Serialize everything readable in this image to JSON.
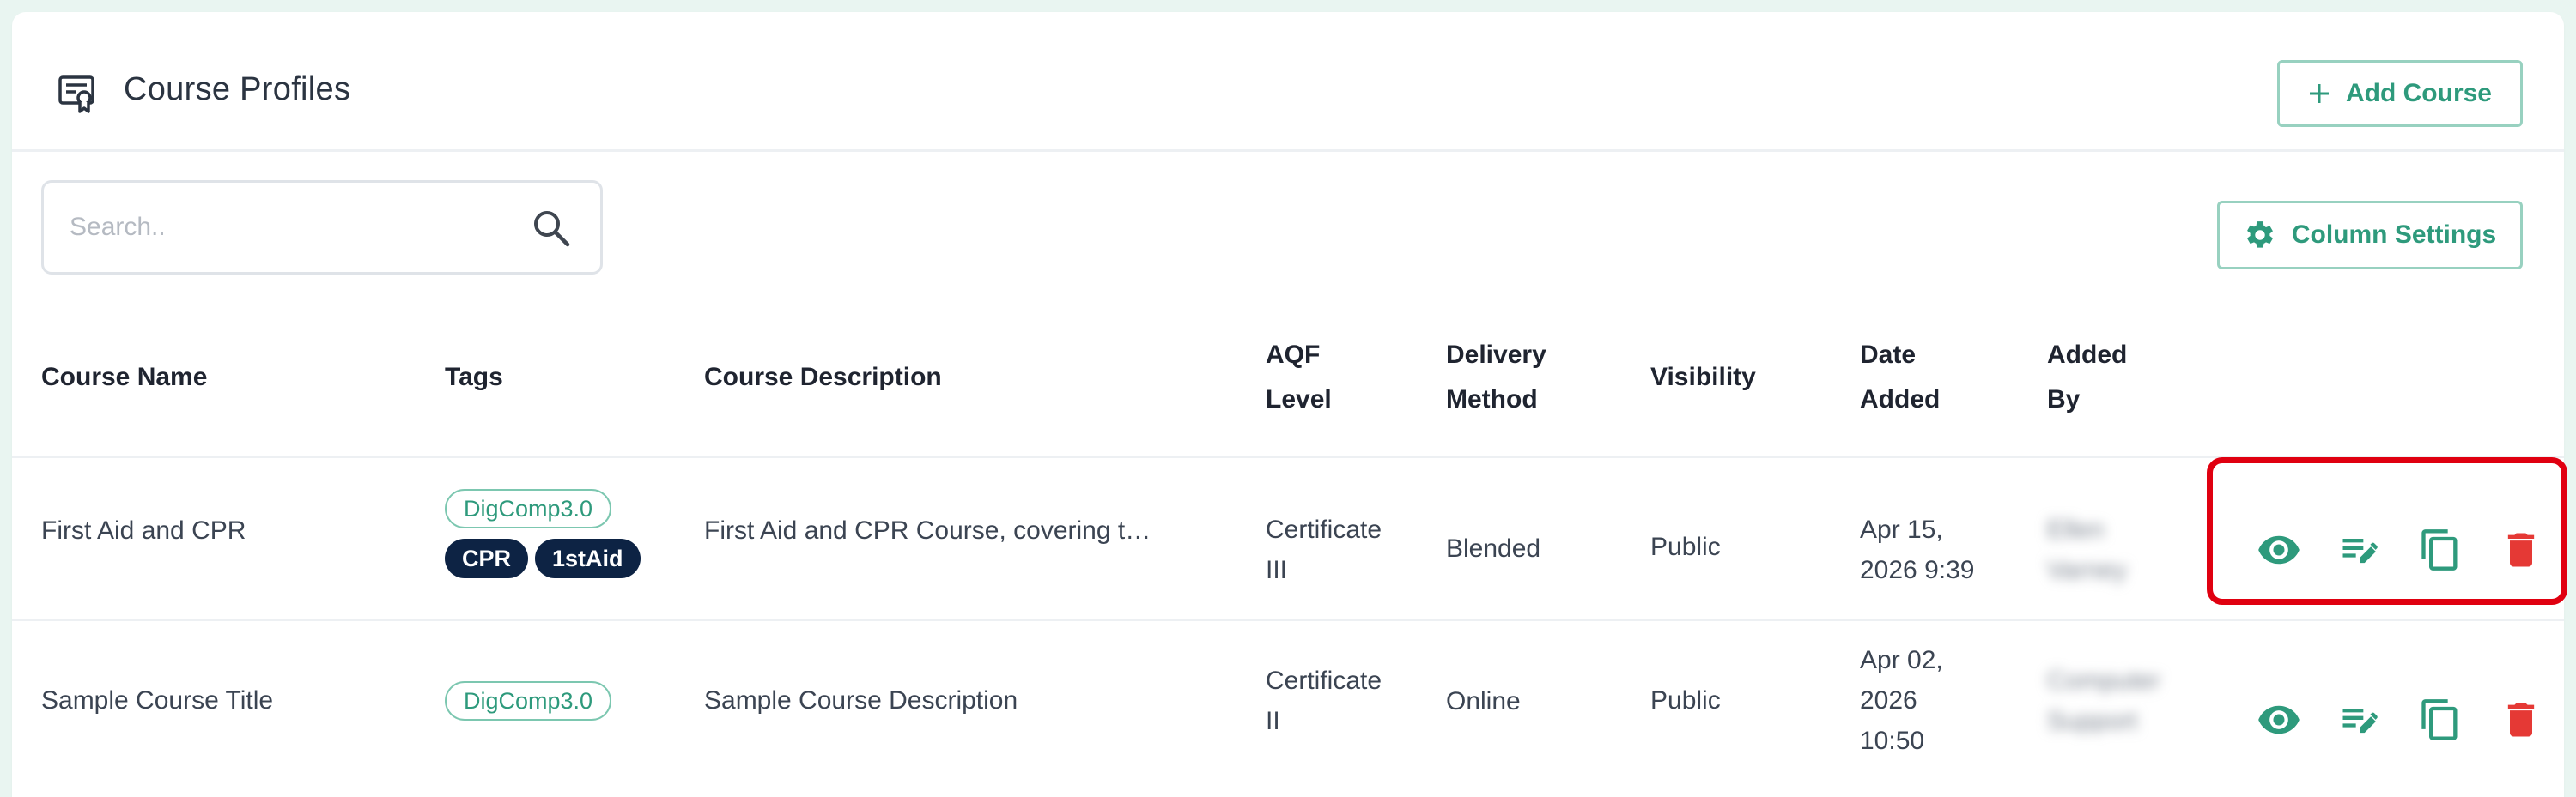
{
  "header": {
    "title": "Course Profiles",
    "icon": "certificate-icon",
    "add_button_label": "Add Course"
  },
  "search": {
    "placeholder": "Search..",
    "value": ""
  },
  "toolbar": {
    "column_settings_label": "Column Settings"
  },
  "table": {
    "columns": {
      "course_name": "Course Name",
      "tags": "Tags",
      "course_description": "Course Description",
      "aqf_level_1": "AQF",
      "aqf_level_2": "Level",
      "delivery_method_1": "Delivery",
      "delivery_method_2": "Method",
      "visibility": "Visibility",
      "date_added_1": "Date",
      "date_added_2": "Added",
      "added_by_1": "Added",
      "added_by_2": "By"
    },
    "rows": [
      {
        "course_name": "First Aid and CPR",
        "tags": [
          "DigComp3.0",
          "CPR",
          "1stAid"
        ],
        "course_description": "First Aid and CPR Course, covering t…",
        "aqf_level_1": "Certificate",
        "aqf_level_2": "III",
        "delivery_method": "Blended",
        "visibility": "Public",
        "date_added_1": "Apr 15,",
        "date_added_2": "2026 9:39",
        "added_by_1": "Ellen",
        "added_by_2": "Varney"
      },
      {
        "course_name": "Sample Course Title",
        "tags": [
          "DigComp3.0"
        ],
        "course_description": "Sample Course Description",
        "aqf_level_1": "Certificate",
        "aqf_level_2": "II",
        "delivery_method": "Online",
        "visibility": "Public",
        "date_added_1": "Apr 02,",
        "date_added_2": "2026",
        "date_added_3": "10:50",
        "added_by_1": "Computer",
        "added_by_2": "Support"
      }
    ]
  },
  "actions": [
    "view-icon",
    "edit-icon",
    "copy-icon",
    "delete-icon"
  ],
  "colors": {
    "accent": "#2e9a7c",
    "tag_dark": "#0d2344",
    "danger": "#e53935",
    "highlight": "#e00010"
  }
}
